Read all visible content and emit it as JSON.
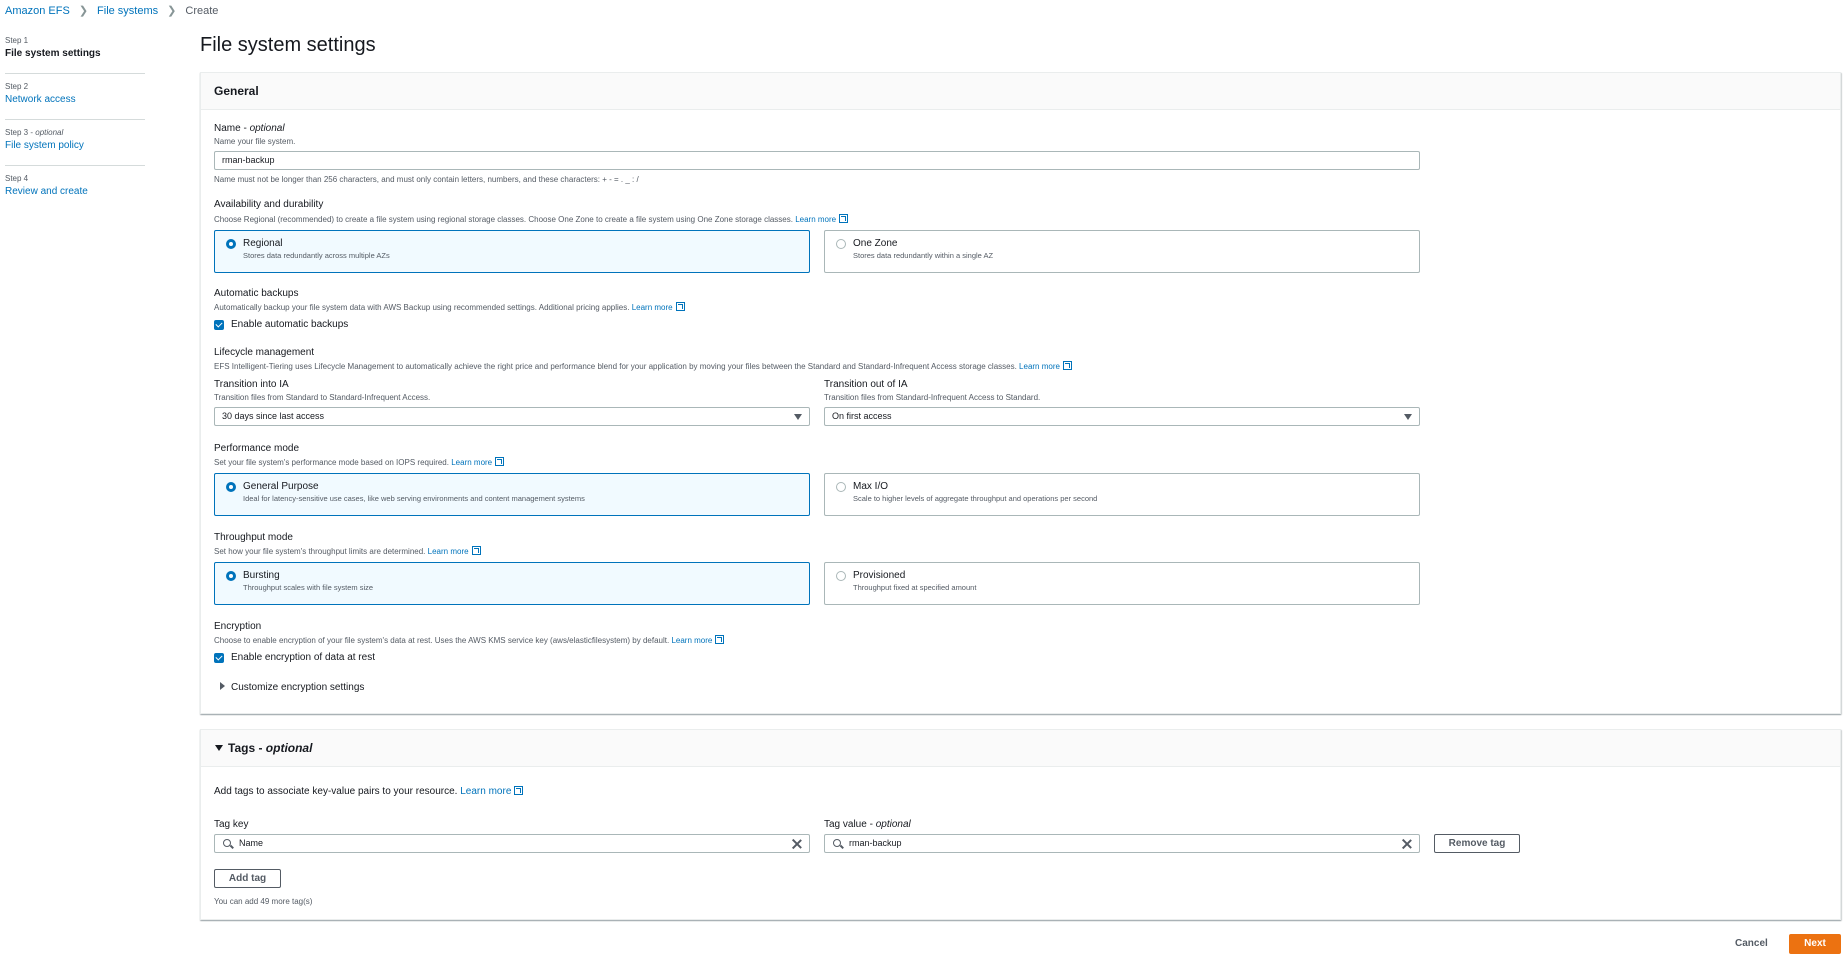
{
  "breadcrumb": {
    "items": [
      "Amazon EFS",
      "File systems"
    ],
    "current": "Create"
  },
  "steps": [
    {
      "num": "Step 1",
      "optional": "",
      "title": "File system settings",
      "active": true
    },
    {
      "num": "Step 2",
      "optional": "",
      "title": "Network access",
      "active": false
    },
    {
      "num": "Step 3 - ",
      "optional": "optional",
      "title": "File system policy",
      "active": false
    },
    {
      "num": "Step 4",
      "optional": "",
      "title": "Review and create",
      "active": false
    }
  ],
  "page_title": "File system settings",
  "general": {
    "header": "General",
    "name": {
      "label": "Name - ",
      "label_optional": "optional",
      "description": "Name your file system.",
      "value": "rman-backup",
      "constraint": "Name must not be longer than 256 characters, and must only contain letters, numbers, and these characters: + - = . _ : /"
    },
    "availability": {
      "label": "Availability and durability",
      "description": "Choose Regional (recommended) to create a file system using regional storage classes. Choose One Zone to create a file system using One Zone storage classes.",
      "learn_more": "Learn more",
      "options": [
        {
          "title": "Regional",
          "desc": "Stores data redundantly across multiple AZs",
          "selected": true
        },
        {
          "title": "One Zone",
          "desc": "Stores data redundantly within a single AZ",
          "selected": false
        }
      ]
    },
    "backups": {
      "label": "Automatic backups",
      "description": "Automatically backup your file system data with AWS Backup using recommended settings. Additional pricing applies.",
      "learn_more": "Learn more",
      "checkbox_label": "Enable automatic backups",
      "checked": true
    },
    "lifecycle": {
      "label": "Lifecycle management",
      "description": "EFS Intelligent-Tiering uses Lifecycle Management to automatically achieve the right price and performance blend for your application by moving your files between the Standard and Standard-Infrequent Access storage classes.",
      "learn_more": "Learn more",
      "into_ia": {
        "label": "Transition into IA",
        "desc": "Transition files from Standard to Standard-Infrequent Access.",
        "value": "30 days since last access"
      },
      "out_of_ia": {
        "label": "Transition out of IA",
        "desc": "Transition files from Standard-Infrequent Access to Standard.",
        "value": "On first access"
      }
    },
    "performance": {
      "label": "Performance mode",
      "description": "Set your file system's performance mode based on IOPS required.",
      "learn_more": "Learn more",
      "options": [
        {
          "title": "General Purpose",
          "desc": "Ideal for latency-sensitive use cases, like web serving environments and content management systems",
          "selected": true
        },
        {
          "title": "Max I/O",
          "desc": "Scale to higher levels of aggregate throughput and operations per second",
          "selected": false
        }
      ]
    },
    "throughput": {
      "label": "Throughput mode",
      "description": "Set how your file system's throughput limits are determined.",
      "learn_more": "Learn more",
      "options": [
        {
          "title": "Bursting",
          "desc": "Throughput scales with file system size",
          "selected": true
        },
        {
          "title": "Provisioned",
          "desc": "Throughput fixed at specified amount",
          "selected": false
        }
      ]
    },
    "encryption": {
      "label": "Encryption",
      "description": "Choose to enable encryption of your file system's data at rest. Uses the AWS KMS service key (aws/elasticfilesystem) by default.",
      "learn_more": "Learn more",
      "checkbox_label": "Enable encryption of data at rest",
      "checked": true,
      "customize": "Customize encryption settings"
    }
  },
  "tags": {
    "header": "Tags - ",
    "header_optional": "optional",
    "description": "Add tags to associate key-value pairs to your resource.",
    "learn_more": "Learn more",
    "key_label": "Tag key",
    "value_label": "Tag value - ",
    "value_label_optional": "optional",
    "key_value": "Name",
    "value_value": "rman-backup",
    "remove_button": "Remove tag",
    "add_button": "Add tag",
    "remaining": "You can add 49 more tag(s)"
  },
  "footer": {
    "cancel": "Cancel",
    "next": "Next"
  },
  "colors": {
    "accent": "#0073bb",
    "primary": "#ec7211",
    "selected_bg": "#f1faff"
  }
}
